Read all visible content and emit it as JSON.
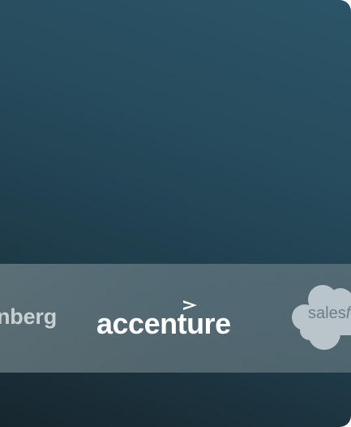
{
  "logos": {
    "bloomberg_partial": "nberg",
    "accenture": "accenture",
    "salesforce_partial": "sales",
    "salesforce_partial_italic": "fo"
  },
  "colors": {
    "background_top": "#2b5568",
    "background_bottom": "#17262e",
    "strip": "#7d8e94",
    "accenture_text": "#ffffff",
    "bloomberg_text": "#c7d0d3",
    "salesforce_cloud": "#b9c5ca",
    "salesforce_text": "#6d7e85"
  }
}
